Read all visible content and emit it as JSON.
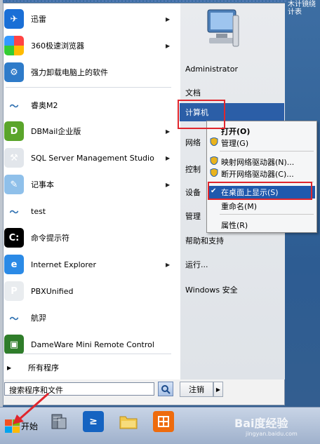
{
  "corner_text": "木计镜绕计表",
  "programs": [
    {
      "label": "迅雷",
      "icon": "thunder-bird-icon",
      "has_submenu": true
    },
    {
      "label": "360极速浏览器",
      "icon": "browser-360-icon",
      "has_submenu": true
    },
    {
      "label": "强力卸载电脑上的软件",
      "icon": "uninstaller-icon",
      "has_submenu": false
    },
    {
      "label": "睿奥M2",
      "icon": "bird-app-icon",
      "has_submenu": false
    },
    {
      "label": "DBMail企业版",
      "icon": "dbmail-icon",
      "has_submenu": true
    },
    {
      "label": "SQL Server Management Studio",
      "icon": "sql-server-icon",
      "has_submenu": true
    },
    {
      "label": "记事本",
      "icon": "notepad-icon",
      "has_submenu": true
    },
    {
      "label": "test",
      "icon": "bird-app-icon",
      "has_submenu": false
    },
    {
      "label": "命令提示符",
      "icon": "cmd-icon",
      "has_submenu": false
    },
    {
      "label": "Internet Explorer",
      "icon": "ie-icon",
      "has_submenu": true
    },
    {
      "label": "PBXUnified",
      "icon": "pbx-icon",
      "has_submenu": false
    },
    {
      "label": "航羿",
      "icon": "bird-app-icon",
      "has_submenu": false
    },
    {
      "label": "DameWare Mini Remote Control",
      "icon": "dameware-icon",
      "has_submenu": false
    }
  ],
  "all_programs": "所有程序",
  "search_placeholder": "搜索程序和文件",
  "shutdown_label": "注销",
  "right_items": {
    "user": "Administrator",
    "documents": "文档",
    "computer": "计算机",
    "network": "网络",
    "control": "控制",
    "devices": "设备",
    "admin": "管理",
    "help": "帮助和支持",
    "run": "运行...",
    "security": "Windows 安全"
  },
  "context_menu": {
    "open": "打开(O)",
    "manage": "管理(G)",
    "map_drive": "映射网络驱动器(N)...",
    "disconnect_drive": "断开网络驱动器(C)...",
    "show_on_desktop": "在桌面上显示(S)",
    "rename": "重命名(M)",
    "properties": "属性(R)"
  },
  "taskbar": {
    "start_label": "开始"
  },
  "watermark": {
    "brand": "Bai度经验",
    "url": "jingyan.baidu.com"
  }
}
